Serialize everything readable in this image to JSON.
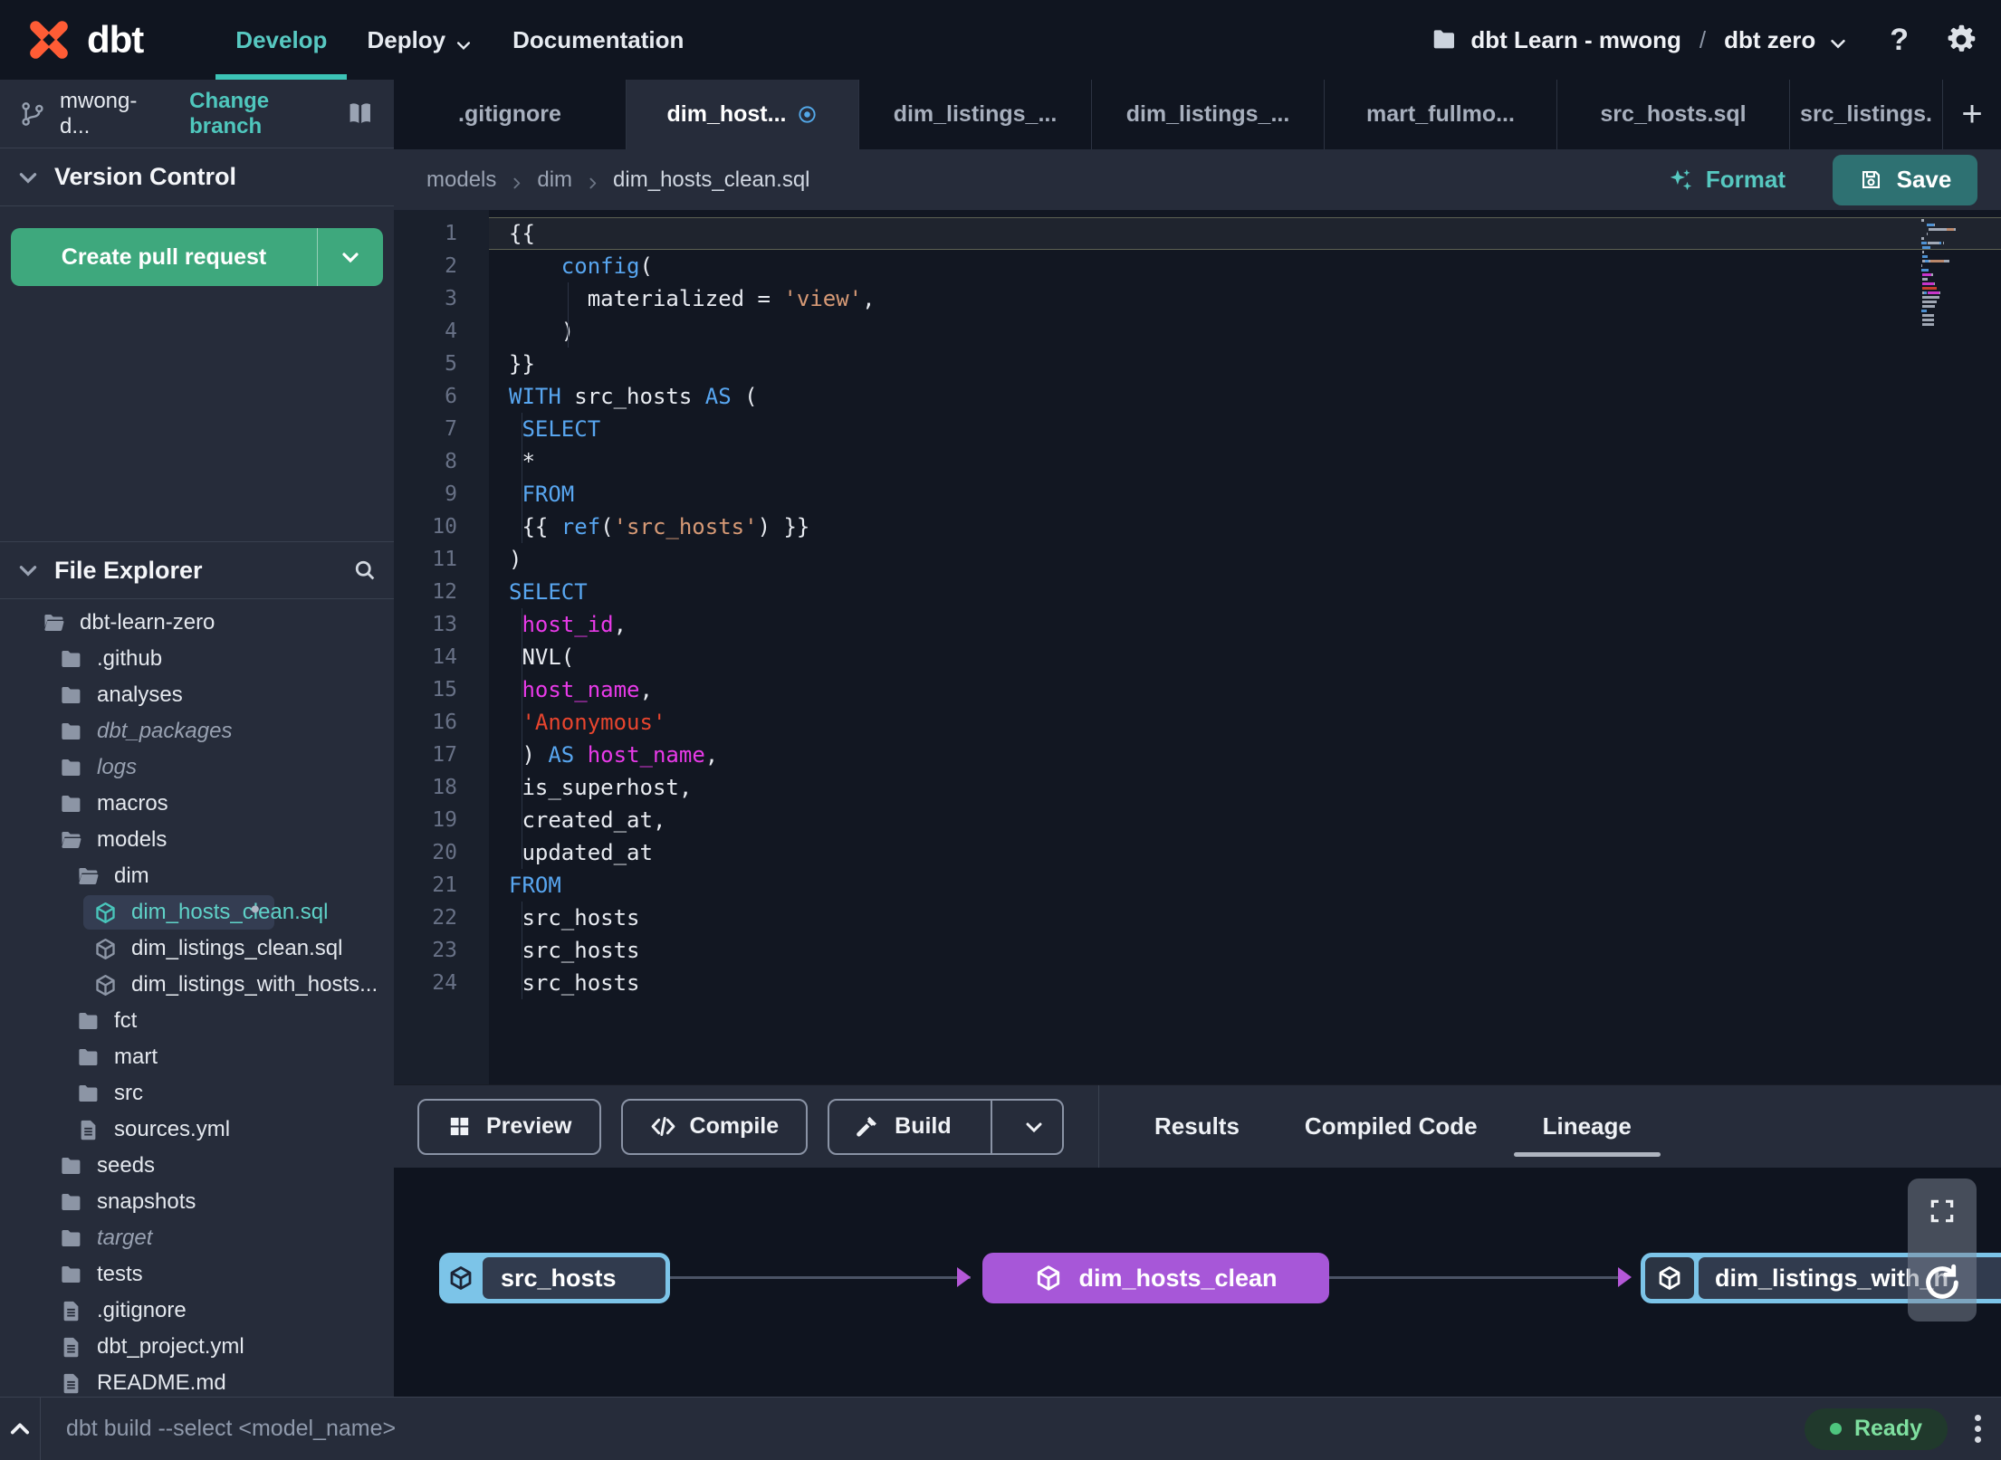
{
  "topnav": {
    "logo_text": "dbt",
    "nav": [
      {
        "label": "Develop",
        "active": true
      },
      {
        "label": "Deploy",
        "caret": true
      },
      {
        "label": "Documentation"
      }
    ],
    "project_account": "dbt Learn - mwong",
    "project_separator": "/",
    "project_env": "dbt zero",
    "help_label": "?"
  },
  "sidebar": {
    "branch_name": "mwong-d...",
    "change_branch_label": "Change branch",
    "version_control_title": "Version Control",
    "create_pr_label": "Create pull request",
    "file_explorer_title": "File Explorer",
    "tree": [
      {
        "label": "dbt-learn-zero",
        "icon": "folder-open",
        "depth": 0
      },
      {
        "label": ".github",
        "icon": "folder",
        "depth": 1
      },
      {
        "label": "analyses",
        "icon": "folder",
        "depth": 1
      },
      {
        "label": "dbt_packages",
        "icon": "folder",
        "depth": 1,
        "italic": true
      },
      {
        "label": "logs",
        "icon": "folder",
        "depth": 1,
        "italic": true
      },
      {
        "label": "macros",
        "icon": "folder",
        "depth": 1
      },
      {
        "label": "models",
        "icon": "folder-open",
        "depth": 1
      },
      {
        "label": "dim",
        "icon": "folder-open",
        "depth": 2
      },
      {
        "label": "dim_hosts_clean.sql",
        "icon": "cube",
        "depth": 3,
        "selected": true,
        "modified": true
      },
      {
        "label": "dim_listings_clean.sql",
        "icon": "cube",
        "depth": 3
      },
      {
        "label": "dim_listings_with_hosts...",
        "icon": "cube",
        "depth": 3
      },
      {
        "label": "fct",
        "icon": "folder",
        "depth": 2
      },
      {
        "label": "mart",
        "icon": "folder",
        "depth": 2
      },
      {
        "label": "src",
        "icon": "folder",
        "depth": 2
      },
      {
        "label": "sources.yml",
        "icon": "file",
        "depth": 2
      },
      {
        "label": "seeds",
        "icon": "folder",
        "depth": 1
      },
      {
        "label": "snapshots",
        "icon": "folder",
        "depth": 1
      },
      {
        "label": "target",
        "icon": "folder",
        "depth": 1,
        "italic": true
      },
      {
        "label": "tests",
        "icon": "folder",
        "depth": 1
      },
      {
        "label": ".gitignore",
        "icon": "file",
        "depth": 1
      },
      {
        "label": "dbt_project.yml",
        "icon": "file",
        "depth": 1
      },
      {
        "label": "README.md",
        "icon": "file",
        "depth": 1
      }
    ]
  },
  "tabbar": {
    "tabs": [
      {
        "label": ".gitignore"
      },
      {
        "label": "dim_host...",
        "active": true,
        "modified": true
      },
      {
        "label": "dim_listings_..."
      },
      {
        "label": "dim_listings_..."
      },
      {
        "label": "mart_fullmo..."
      },
      {
        "label": "src_hosts.sql"
      },
      {
        "label": "src_listings.",
        "cut": true
      }
    ],
    "new_tab_label": "+"
  },
  "editor": {
    "breadcrumb": [
      "models",
      "dim",
      "dim_hosts_clean.sql"
    ],
    "format_label": "Format",
    "save_label": "Save",
    "lines": [
      {
        "active": true,
        "segments": [
          [
            "p",
            "{{"
          ]
        ]
      },
      {
        "segments": [
          [
            "p",
            "    "
          ],
          [
            "k",
            "config"
          ],
          [
            "p",
            "("
          ]
        ]
      },
      {
        "segments": [
          [
            "p",
            "      materialized = "
          ],
          [
            "s",
            "'view'"
          ],
          [
            "p",
            ","
          ]
        ]
      },
      {
        "segments": [
          [
            "p",
            "    )"
          ]
        ]
      },
      {
        "segments": [
          [
            "p",
            "}}"
          ]
        ]
      },
      {
        "segments": [
          [
            "k",
            "WITH"
          ],
          [
            "p",
            " src_hosts "
          ],
          [
            "k",
            "AS"
          ],
          [
            "p",
            " ("
          ]
        ]
      },
      {
        "segments": [
          [
            "p",
            " "
          ],
          [
            "k",
            "SELECT"
          ]
        ]
      },
      {
        "segments": [
          [
            "p",
            " *"
          ]
        ]
      },
      {
        "segments": [
          [
            "p",
            " "
          ],
          [
            "k",
            "FROM"
          ]
        ]
      },
      {
        "segments": [
          [
            "p",
            " {{ "
          ],
          [
            "k",
            "ref"
          ],
          [
            "p",
            "("
          ],
          [
            "s",
            "'src_hosts'"
          ],
          [
            "p",
            ") }}"
          ]
        ]
      },
      {
        "segments": [
          [
            "p",
            ")"
          ]
        ]
      },
      {
        "segments": [
          [
            "k",
            "SELECT"
          ]
        ]
      },
      {
        "segments": [
          [
            "p",
            " "
          ],
          [
            "f",
            "host_id"
          ],
          [
            "p",
            ","
          ]
        ]
      },
      {
        "segments": [
          [
            "p",
            " NVL("
          ]
        ]
      },
      {
        "segments": [
          [
            "p",
            " "
          ],
          [
            "f",
            "host_name"
          ],
          [
            "p",
            ","
          ]
        ]
      },
      {
        "segments": [
          [
            "p",
            " "
          ],
          [
            "r",
            "'Anonymous'"
          ]
        ]
      },
      {
        "segments": [
          [
            "p",
            " ) "
          ],
          [
            "k",
            "AS"
          ],
          [
            "p",
            " "
          ],
          [
            "f",
            "host_name"
          ],
          [
            "p",
            ","
          ]
        ]
      },
      {
        "segments": [
          [
            "p",
            " is_superhost,"
          ]
        ]
      },
      {
        "segments": [
          [
            "p",
            " created_at,"
          ]
        ]
      },
      {
        "segments": [
          [
            "p",
            " updated_at"
          ]
        ]
      },
      {
        "segments": [
          [
            "k",
            "FROM"
          ]
        ]
      },
      {
        "segments": [
          [
            "p",
            " src_hosts"
          ]
        ]
      },
      {
        "segments": [
          [
            "p",
            " src_hosts"
          ]
        ]
      },
      {
        "segments": [
          [
            "p",
            " src_hosts"
          ]
        ]
      }
    ]
  },
  "bottom_panel": {
    "preview_label": "Preview",
    "compile_label": "Compile",
    "build_label": "Build",
    "result_tabs": [
      {
        "label": "Results"
      },
      {
        "label": "Compiled Code"
      },
      {
        "label": "Lineage",
        "active": true
      }
    ]
  },
  "lineage": {
    "nodes": [
      {
        "label": "src_hosts",
        "kind": "source"
      },
      {
        "label": "dim_hosts_clean",
        "kind": "model"
      },
      {
        "label": "dim_listings_with_h",
        "kind": "model"
      }
    ]
  },
  "statusbar": {
    "command_placeholder": "dbt build --select <model_name>",
    "status_label": "Ready"
  },
  "colors": {
    "accent_teal": "#52c4bb",
    "button_green": "#3ea87d",
    "save_teal": "#2e7172",
    "node_blue": "#7cc4e8",
    "node_purple": "#a757d8",
    "arrow_purple": "#b558d8",
    "status_green": "#4ec57e",
    "keyword_blue": "#58a6f0",
    "string_salmon": "#d79a76",
    "string_red": "#e8452e",
    "identifier_magenta": "#e83ae8",
    "logo_orange": "#ff5c35"
  }
}
